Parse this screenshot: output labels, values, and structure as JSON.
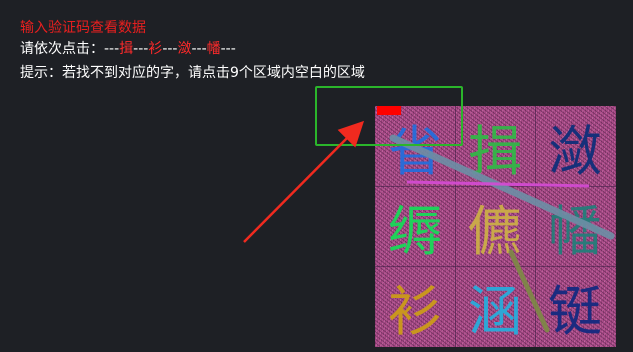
{
  "title": "输入验证码查看数据",
  "order_prompt": "请依次点击：",
  "order_sep": "---",
  "order_chars": [
    "揖",
    "衫",
    "潋",
    "幡"
  ],
  "tip": "提示：若找不到对应的字，请点击9个区域内空白的区域",
  "captcha": {
    "cells": [
      {
        "char": "省",
        "color": "#2b6bd6"
      },
      {
        "char": "揖",
        "color": "#38b04a"
      },
      {
        "char": "潋",
        "color": "#16307a"
      },
      {
        "char": "缛",
        "color": "#1fd15a"
      },
      {
        "char": "儦",
        "color": "#c9a84a"
      },
      {
        "char": "幡",
        "color": "#2a7a7a"
      },
      {
        "char": "衫",
        "color": "#c9961e"
      },
      {
        "char": "涵",
        "color": "#2ea6d6"
      },
      {
        "char": "铤",
        "color": "#1b2b80"
      }
    ]
  },
  "colors": {
    "title": "#e81f1f",
    "highlight": "#ff2a2a",
    "arrow": "#f02a1f",
    "select_box": "#2bb52b"
  }
}
